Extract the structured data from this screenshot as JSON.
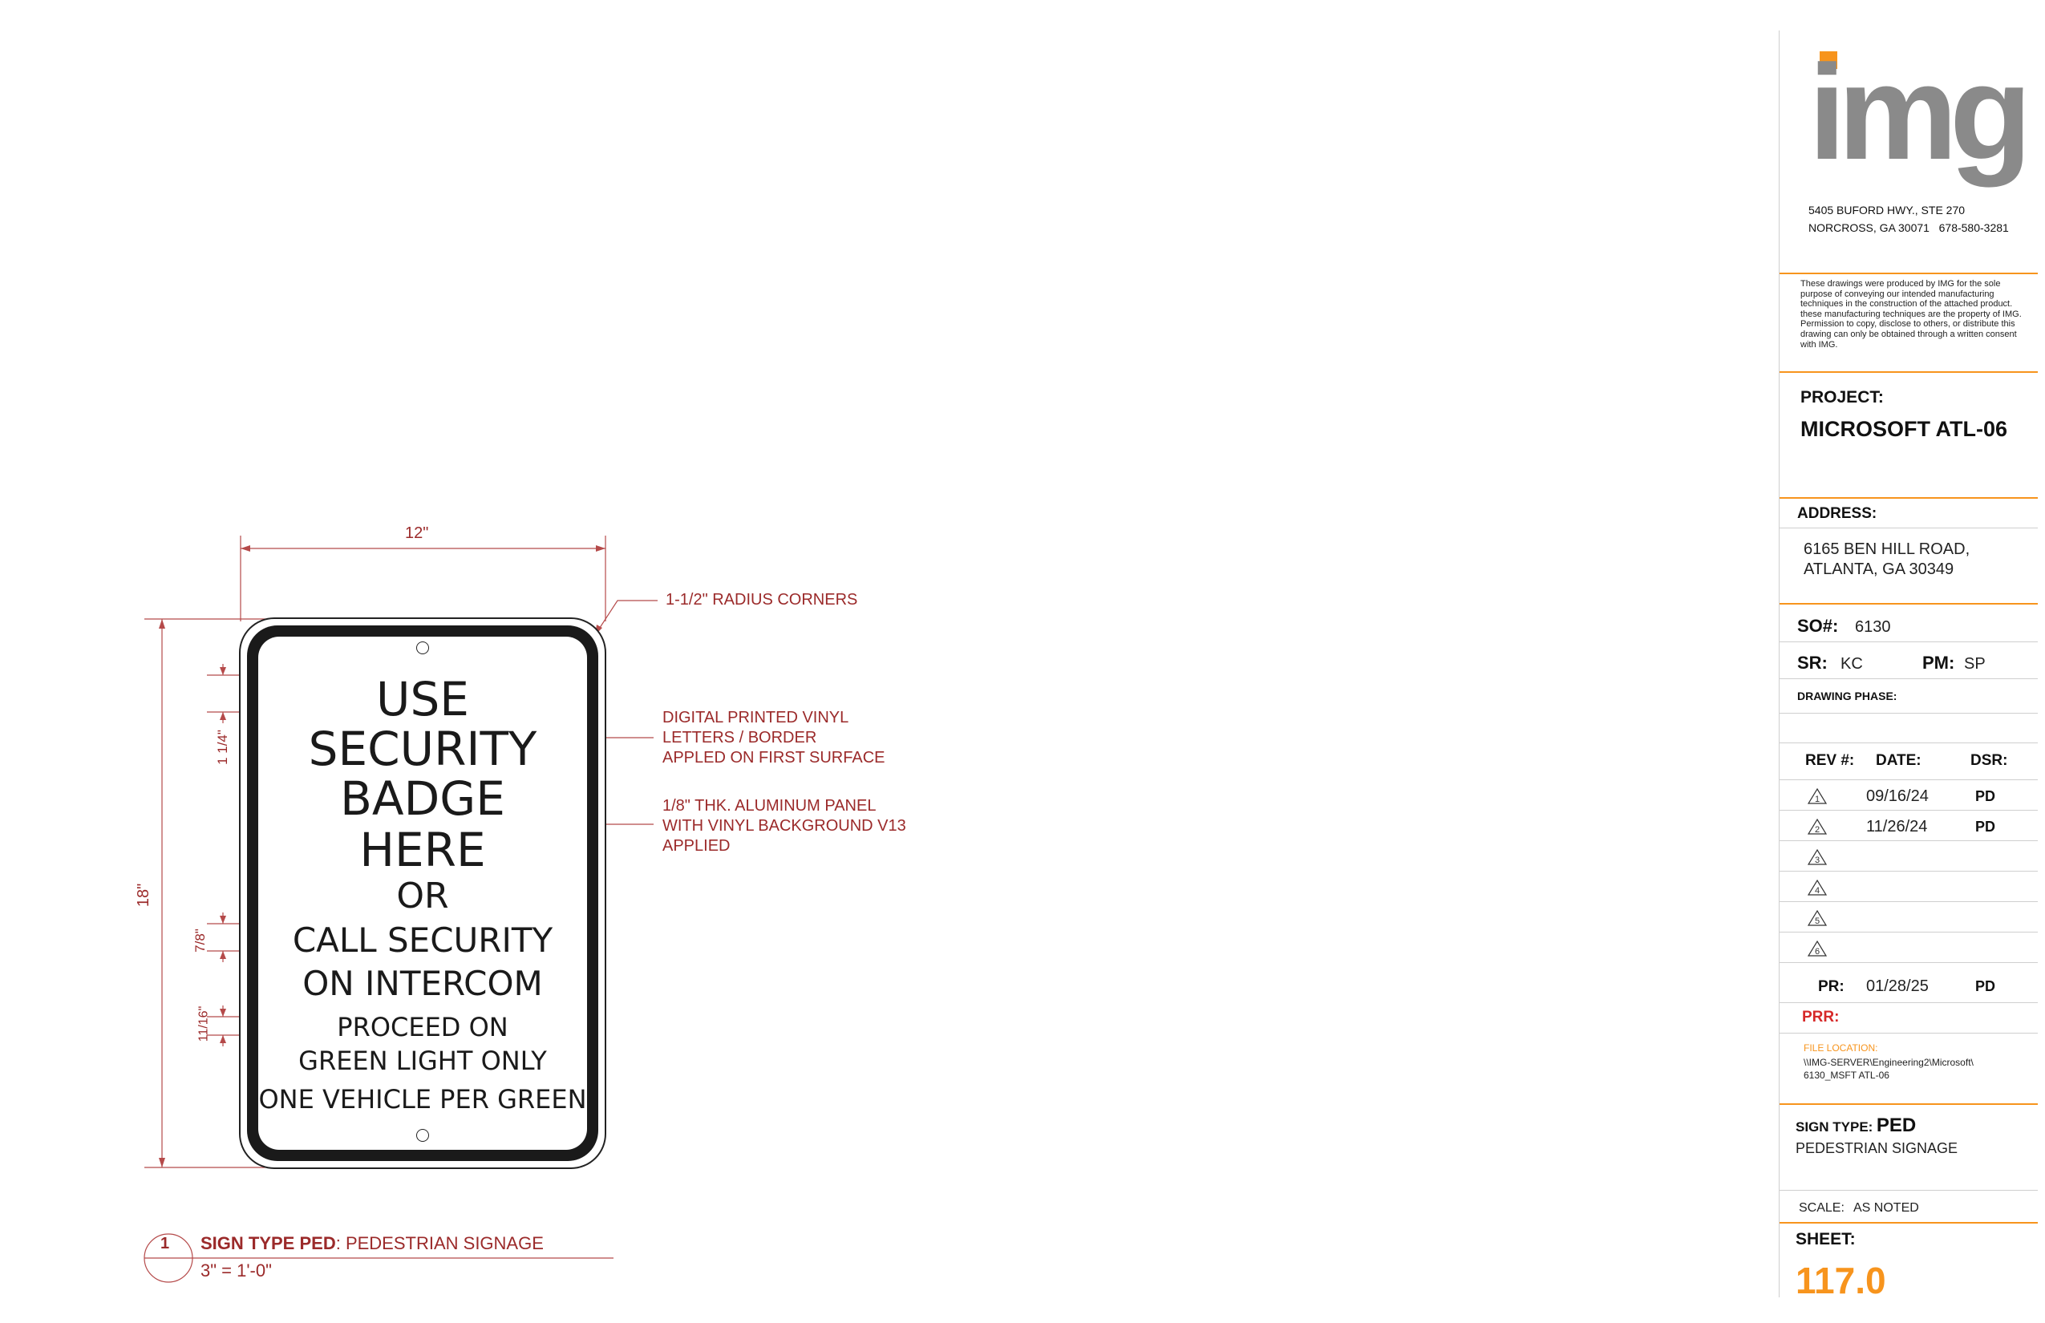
{
  "sign": {
    "lines": [
      "USE",
      "SECURITY",
      "BADGE",
      "HERE",
      "OR",
      "CALL SECURITY",
      "ON INTERCOM",
      "PROCEED ON",
      "GREEN LIGHT ONLY",
      "ONE VEHICLE PER GREEN"
    ]
  },
  "dimensions": {
    "width": "12\"",
    "height": "18\"",
    "d1": "1 1/4\"",
    "d2": "7/8\"",
    "d3": "11/16\""
  },
  "callouts": {
    "corners": "1-1/2\" RADIUS CORNERS",
    "vinyl": "DIGITAL PRINTED VINYL\nLETTERS / BORDER\nAPPLED ON FIRST SURFACE",
    "panel": "1/8\" THK. ALUMINUM PANEL\nWITH VINYL BACKGROUND V13\nAPPLIED"
  },
  "detail": {
    "number": "1",
    "title_bold": "SIGN TYPE PED",
    "title_rest": ": PEDESTRIAN SIGNAGE",
    "scale": "3\" = 1'-0\""
  },
  "titleblock": {
    "logo": "img",
    "address_line1": "5405 BUFORD HWY., STE 270",
    "address_line2": "NORCROSS, GA 30071   678-580-3281",
    "disclaimer": "These drawings were produced by IMG for the sole purpose of conveying our intended manufacturing techniques in the construction of the attached product. these manufacturing techniques are the property of IMG. Permission to copy, disclose to others, or distribute this drawing can only be obtained through a written consent with IMG.",
    "project_label": "PROJECT:",
    "project_value": "MICROSOFT ATL-06",
    "address_label": "ADDRESS:",
    "site_line1": "6165 BEN HILL ROAD,",
    "site_line2": "ATLANTA, GA 30349",
    "so_label": "SO#:",
    "so_value": "6130",
    "sr_label": "SR:",
    "sr_value": "KC",
    "pm_label": "PM:",
    "pm_value": "SP",
    "phase_label": "DRAWING PHASE:",
    "rev_headers": [
      "REV #:",
      "DATE:",
      "DSR:"
    ],
    "revs": [
      {
        "num": "1",
        "date": "09/16/24",
        "dsr": "PD"
      },
      {
        "num": "2",
        "date": "11/26/24",
        "dsr": "PD"
      },
      {
        "num": "3",
        "date": "",
        "dsr": ""
      },
      {
        "num": "4",
        "date": "",
        "dsr": ""
      },
      {
        "num": "5",
        "date": "",
        "dsr": ""
      },
      {
        "num": "6",
        "date": "",
        "dsr": ""
      }
    ],
    "pr_label": "PR:",
    "pr_date": "01/28/25",
    "pr_dsr": "PD",
    "prr_label": "PRR:",
    "file_label": "FILE LOCATION:",
    "file_line1": "\\\\IMG-SERVER\\Engineering2\\Microsoft\\",
    "file_line2": "6130_MSFT ATL-06",
    "sign_type_label": "SIGN TYPE:",
    "sign_type_value": "PED",
    "sign_type_desc": "PEDESTRIAN SIGNAGE",
    "scale_label": "SCALE:",
    "scale_value": "AS NOTED",
    "sheet_label": "SHEET:",
    "sheet_value": "117.0"
  },
  "colors": {
    "accent": "#f7941d",
    "dimension": "#9b2a2a",
    "logo_gray": "#8a8a8a"
  }
}
